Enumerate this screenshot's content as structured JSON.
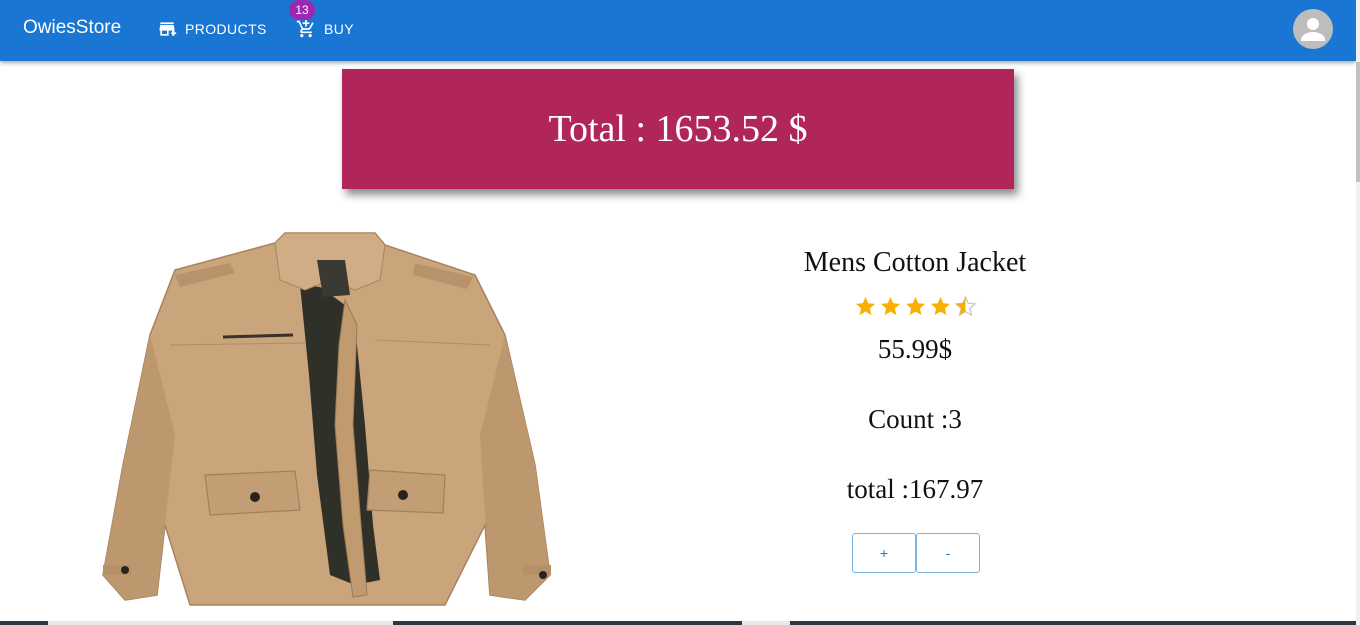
{
  "appbar": {
    "brand": "OwiesStore",
    "nav": {
      "products_label": "PRODUCTS",
      "buy_label": "BUY",
      "cart_badge": "13"
    },
    "color": "#1976d2",
    "badge_color": "#9c27b0"
  },
  "summary": {
    "total_text": "Total : 1653.52 $",
    "color": "#b0265a"
  },
  "product": {
    "title": "Mens Cotton Jacket",
    "rating": 4.5,
    "rating_max": 5,
    "price_text": "55.99$",
    "count_text": "Count :3",
    "total_text": "total :167.97",
    "increment_label": "+",
    "decrement_label": "-",
    "image_icon": "jacket-image",
    "star_color": "#faaf00"
  }
}
